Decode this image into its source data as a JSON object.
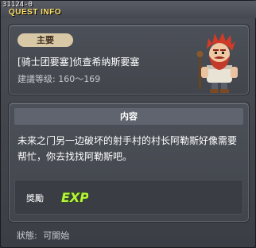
{
  "window": {
    "quest_id": "31124-0",
    "title": "QUEST INFO"
  },
  "quest": {
    "category": "主要",
    "name": "[骑士团要塞]侦查希纳斯要塞",
    "level_label": "建議等级:",
    "level_range": "160～169"
  },
  "content": {
    "header": "内容",
    "description": "未来之门另一边破坏的射手村的村长阿勒斯好像需要帮忙，你去找找阿勒斯吧。"
  },
  "reward": {
    "label": "獎勵",
    "exp_label": "EXP"
  },
  "status": {
    "label": "狀態:",
    "value": "可開始"
  },
  "colors": {
    "title": "#ffe26a",
    "badge": "#d9c8a6",
    "exp_green": "#b6f23a"
  },
  "icons": {
    "npc": "npc-portrait-icon",
    "exp": "exp-reward-icon"
  }
}
